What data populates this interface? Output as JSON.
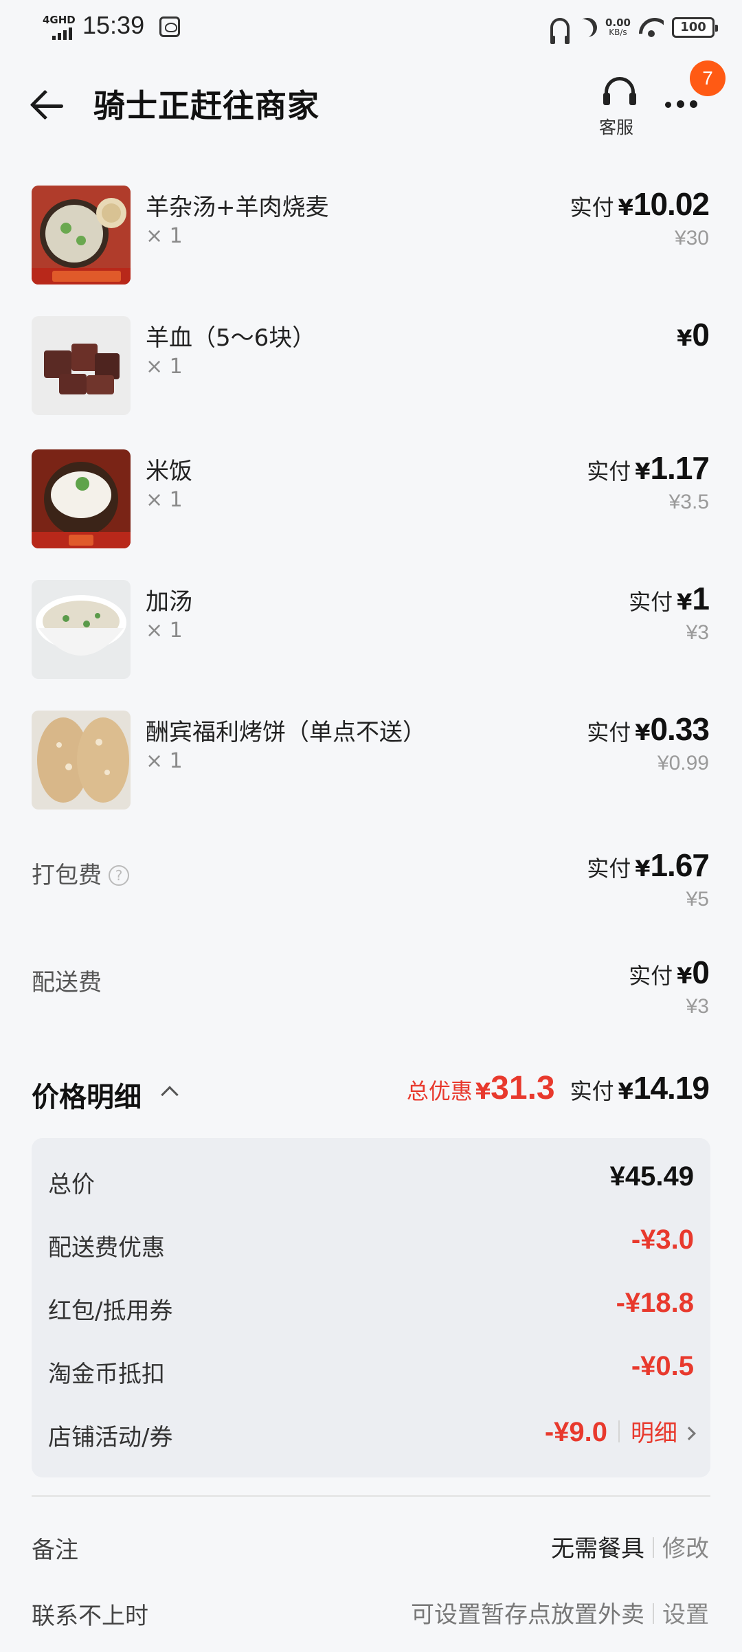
{
  "status_bar": {
    "network": "4GHD",
    "time": "15:39",
    "speed_value": "0.00",
    "speed_unit": "KB/s",
    "battery": "100"
  },
  "nav": {
    "title": "骑士正赶往商家",
    "service_label": "客服",
    "badge_count": "7"
  },
  "items": [
    {
      "name": "羊杂汤+羊肉烧麦",
      "qty": "× 1",
      "pay_label": "实付",
      "currency": "¥",
      "amount": "10.02",
      "original": "¥30",
      "thumb": "soup-lamb-icon"
    },
    {
      "name": "羊血（5～6块）",
      "qty": "× 1",
      "pay_label": "",
      "currency": "¥",
      "amount": "0",
      "original": "",
      "thumb": "blood-tofu-icon"
    },
    {
      "name": "米饭",
      "qty": "× 1",
      "pay_label": "实付",
      "currency": "¥",
      "amount": "1.17",
      "original": "¥3.5",
      "thumb": "rice-bowl-icon"
    },
    {
      "name": "加汤",
      "qty": "× 1",
      "pay_label": "实付",
      "currency": "¥",
      "amount": "1",
      "original": "¥3",
      "thumb": "soup-bowl-icon"
    },
    {
      "name": "酬宾福利烤饼（单点不送）",
      "qty": "× 1",
      "pay_label": "实付",
      "currency": "¥",
      "amount": "0.33",
      "original": "¥0.99",
      "thumb": "flatbread-icon"
    }
  ],
  "fees": {
    "packing": {
      "label": "打包费",
      "pay_label": "实付",
      "currency": "¥",
      "amount": "1.67",
      "original": "¥5"
    },
    "delivery": {
      "label": "配送费",
      "pay_label": "实付",
      "currency": "¥",
      "amount": "0",
      "original": "¥3"
    }
  },
  "price_detail": {
    "title": "价格明细",
    "discount_label": "总优惠",
    "currency": "¥",
    "discount_amount": "31.3",
    "pay_label": "实付",
    "pay_amount": "14.19",
    "rows": [
      {
        "label": "总价",
        "value": "¥45.49"
      },
      {
        "label": "配送费优惠",
        "value": "-¥3.0"
      },
      {
        "label": "红包/抵用券",
        "value": "-¥18.8"
      },
      {
        "label": "淘金币抵扣",
        "value": "-¥0.5"
      },
      {
        "label": "店铺活动/券",
        "value": "-¥9.0"
      }
    ],
    "detail_link": "明细"
  },
  "remark": {
    "label": "备注",
    "value": "无需餐具",
    "action": "修改"
  },
  "unreachable": {
    "label": "联系不上时",
    "value": "可设置暂存点放置外卖",
    "action": "设置"
  },
  "colors": {
    "accent_red": "#e8392d",
    "badge_orange": "#ff5a14",
    "background": "#f6f7f9"
  }
}
